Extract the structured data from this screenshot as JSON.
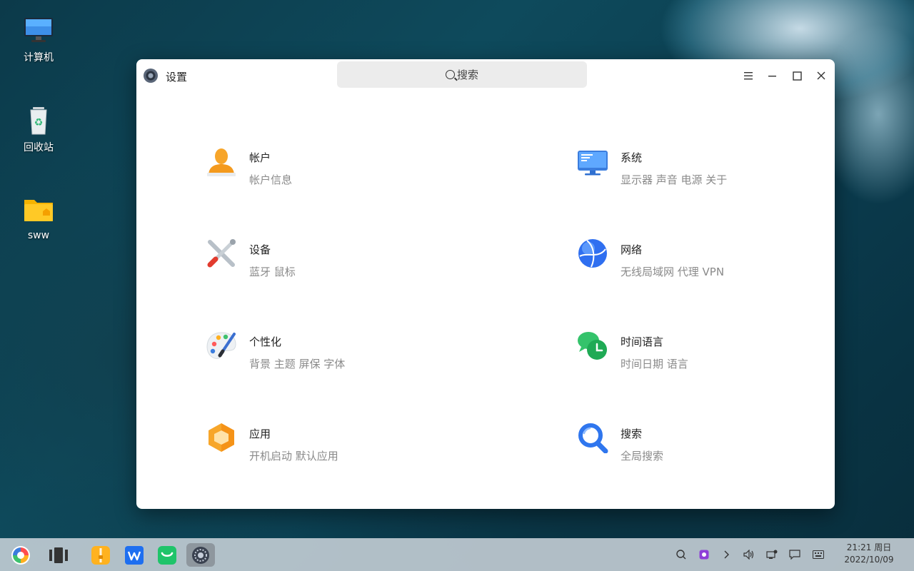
{
  "desktop": {
    "icons": [
      {
        "label": "计算机",
        "icon": "computer-icon"
      },
      {
        "label": "回收站",
        "icon": "recycle-bin-icon"
      },
      {
        "label": "sww",
        "icon": "home-folder-icon"
      }
    ]
  },
  "window": {
    "title": "设置",
    "search_placeholder": "搜索",
    "controls": [
      "menu-icon",
      "minimize-icon",
      "maximize-icon",
      "close-icon"
    ]
  },
  "settings": {
    "items": [
      {
        "name": "帐户",
        "desc": "帐户信息",
        "icon": "account-icon"
      },
      {
        "name": "系统",
        "desc": "显示器 声音 电源 关于",
        "icon": "system-icon"
      },
      {
        "name": "设备",
        "desc": "蓝牙 鼠标",
        "icon": "devices-icon"
      },
      {
        "name": "网络",
        "desc": "无线局域网 代理 VPN",
        "icon": "network-icon"
      },
      {
        "name": "个性化",
        "desc": "背景 主题 屏保 字体",
        "icon": "personalization-icon"
      },
      {
        "name": "时间语言",
        "desc": "时间日期 语言",
        "icon": "time-language-icon"
      },
      {
        "name": "应用",
        "desc": "开机启动 默认应用",
        "icon": "apps-icon"
      },
      {
        "name": "搜索",
        "desc": "全局搜索",
        "icon": "search-icon"
      }
    ]
  },
  "taskbar": {
    "apps": [
      "start-menu-icon",
      "multitask-view-icon",
      "archive-manager-icon",
      "wps-office-icon",
      "wechat-icon",
      "settings-app-icon"
    ],
    "tray": [
      "search-icon",
      "screenshot-icon",
      "expand-tray-icon",
      "volume-icon",
      "network-status-icon",
      "notification-icon",
      "keyboard-icon"
    ],
    "clock": {
      "time": "21:21 周日",
      "date": "2022/10/09"
    }
  },
  "colors": {
    "window_bg": "#ffffff",
    "taskbar_bg": "#c8d2d8",
    "active_app": "#8e979e"
  }
}
